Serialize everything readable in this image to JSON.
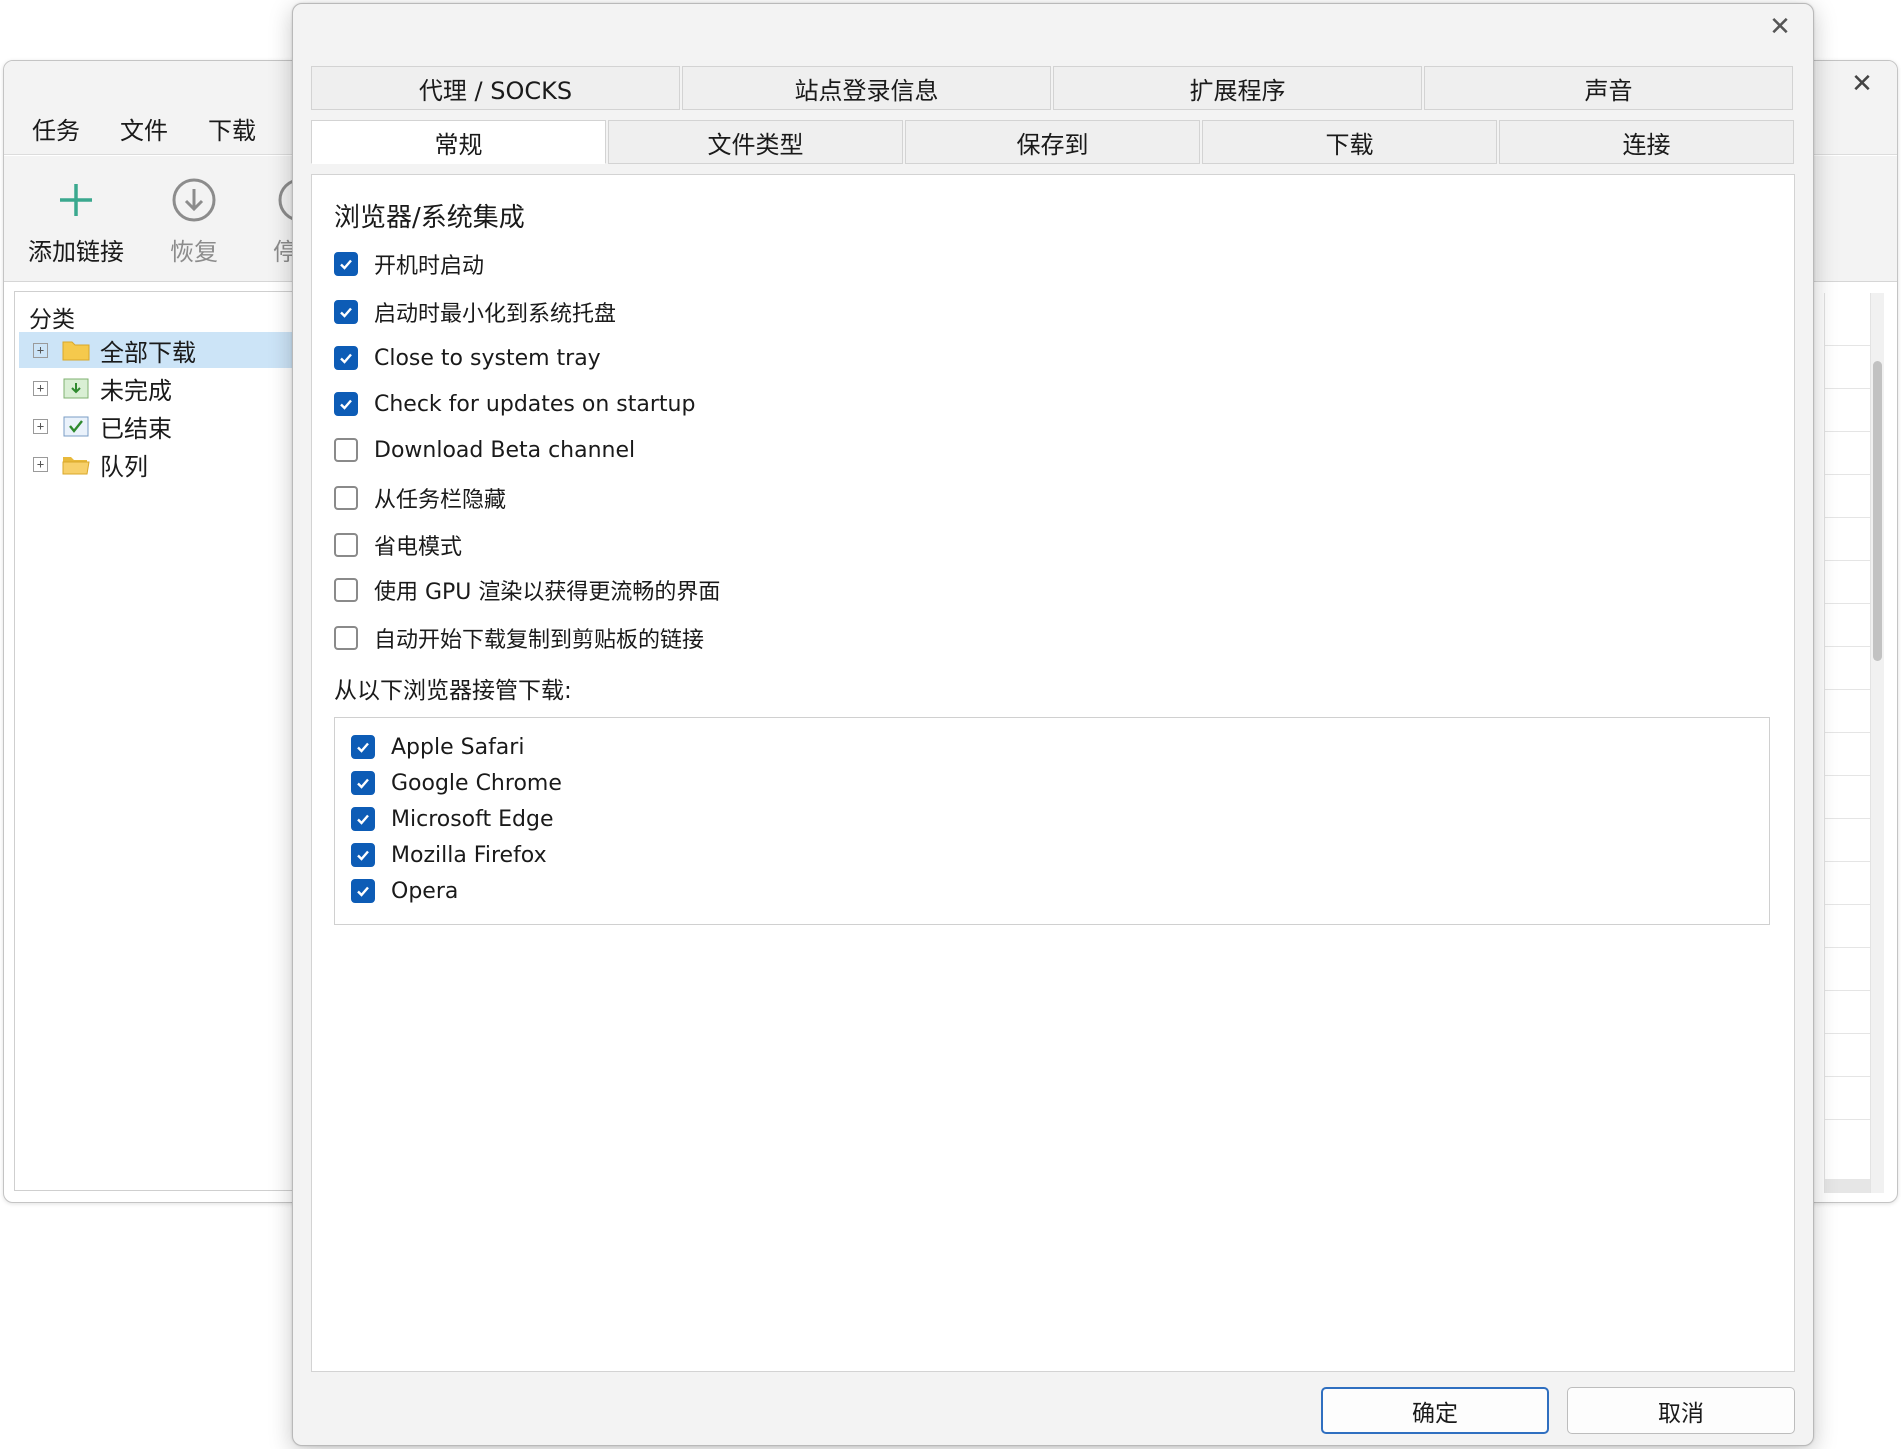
{
  "main_window": {
    "menu": [
      {
        "label": "任务"
      },
      {
        "label": "文件"
      },
      {
        "label": "下载"
      }
    ],
    "toolbar": {
      "add_link": "添加链接",
      "resume": "恢复",
      "pause_partial": "停"
    },
    "sidebar": {
      "title": "分类",
      "items": [
        {
          "label": "全部下载",
          "icon": "folder-icon",
          "selected": true
        },
        {
          "label": "未完成",
          "icon": "download-box-icon",
          "selected": false
        },
        {
          "label": "已结束",
          "icon": "check-box-icon",
          "selected": false
        },
        {
          "label": "队列",
          "icon": "open-folder-icon",
          "selected": false
        }
      ],
      "expander_glyph": "+"
    }
  },
  "dialog": {
    "tabs_row1": [
      {
        "label": "代理 / SOCKS"
      },
      {
        "label": "站点登录信息"
      },
      {
        "label": "扩展程序"
      },
      {
        "label": "声音"
      }
    ],
    "tabs_row2": [
      {
        "label": "常规",
        "active": true
      },
      {
        "label": "文件类型"
      },
      {
        "label": "保存到"
      },
      {
        "label": "下载"
      },
      {
        "label": "连接"
      }
    ],
    "section_heading": "浏览器/系统集成",
    "options": [
      {
        "label": "开机时启动",
        "checked": true
      },
      {
        "label": "启动时最小化到系统托盘",
        "checked": true
      },
      {
        "label": "Close to system tray",
        "checked": true
      },
      {
        "label": "Check for updates on startup",
        "checked": true
      },
      {
        "label": "Download Beta channel",
        "checked": false
      },
      {
        "label": "从任务栏隐藏",
        "checked": false
      },
      {
        "label": "省电模式",
        "checked": false
      },
      {
        "label": "使用 GPU 渲染以获得更流畅的界面",
        "checked": false
      },
      {
        "label": "自动开始下载复制到剪贴板的链接",
        "checked": false
      }
    ],
    "takeover_label": "从以下浏览器接管下载:",
    "browsers": [
      {
        "label": "Apple Safari",
        "checked": true
      },
      {
        "label": "Google Chrome",
        "checked": true
      },
      {
        "label": "Microsoft Edge",
        "checked": true
      },
      {
        "label": "Mozilla Firefox",
        "checked": true
      },
      {
        "label": "Opera",
        "checked": true
      }
    ],
    "ok_label": "确定",
    "cancel_label": "取消",
    "close_glyph": "✕"
  },
  "colors": {
    "accent": "#0d5cb6",
    "selection": "#cce4f7",
    "add_icon": "#3aa88e"
  }
}
